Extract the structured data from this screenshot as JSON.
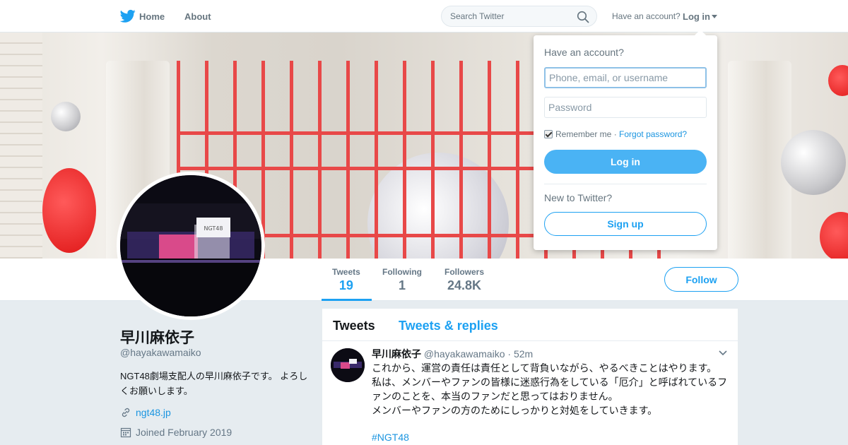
{
  "nav": {
    "bird_icon": "twitter-bird-icon",
    "home_label": "Home",
    "about_label": "About",
    "search_placeholder": "Search Twitter",
    "have_account_label": "Have an account?",
    "login_label": "Log in"
  },
  "profile": {
    "name": "早川麻依子",
    "handle": "@hayakawamaiko",
    "bio": "NGT48劇場支配人の早川麻依子です。 よろしくお願いします。",
    "link": "ngt48.jp",
    "joined": "Joined February 2019",
    "avatar_text": "NGT48",
    "stats": [
      {
        "label": "Tweets",
        "value": "19",
        "active": true
      },
      {
        "label": "Following",
        "value": "1",
        "active": false
      },
      {
        "label": "Followers",
        "value": "24.8K",
        "active": false
      }
    ],
    "follow_label": "Follow"
  },
  "timeline": {
    "tabs": [
      "Tweets",
      "Tweets & replies"
    ],
    "tweet": {
      "name": "早川麻依子",
      "handle": "@hayakawamaiko",
      "time": "· 52m",
      "lines": [
        "これから、運営の責任は責任として背負いながら、やるべきことはやります。",
        "私は、メンバーやファンの皆様に迷惑行為をしている「厄介」と呼ばれているファンのことを、本当のファンだと思ってはおりません。",
        "メンバーやファンの方のためにしっかりと対処をしていきます。"
      ],
      "hashtag": "#NGT48"
    }
  },
  "login_dropdown": {
    "title": "Have an account?",
    "username_placeholder": "Phone, email, or username",
    "password_placeholder": "Password",
    "remember_label": "Remember me",
    "separator": "·",
    "forgot_label": "Forgot password?",
    "login_button": "Log in",
    "new_label": "New to Twitter?",
    "signup_button": "Sign up"
  },
  "colors": {
    "accent": "#1da1f2",
    "link": "#1b95e0",
    "login_button": "#4ab3f4",
    "gate_red": "#e84848"
  }
}
